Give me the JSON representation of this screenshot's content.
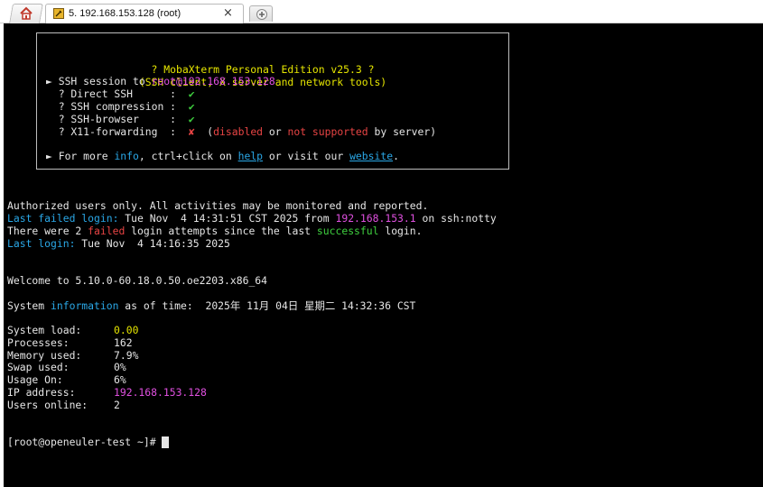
{
  "tabs": {
    "session_title": "5. 192.168.153.128 (root)",
    "close_symbol": "×"
  },
  "banner": {
    "title": "? MobaXterm Personal Edition v25.3 ?",
    "subtitle": "(SSH client, X server and network tools)",
    "session_prefix": "► SSH session to ",
    "session_target": "root@192.168.153.128",
    "direct_ssh": "  ? Direct SSH      :  ",
    "compression": "  ? SSH compression :  ",
    "browser": "  ? SSH-browser     :  ",
    "x11": "  ? X11-forwarding  :  ",
    "check": "✔",
    "cross": "✘",
    "x11_note_1": "  (",
    "x11_note_disabled": "disabled",
    "x11_note_or": " or ",
    "x11_note_not_supported": "not supported",
    "x11_note_end": " by server)",
    "more_prefix": "► For more ",
    "more_info": "info",
    "more_mid": ", ctrl+click on ",
    "more_help": "help",
    "more_mid2": " or visit our ",
    "more_website": "website",
    "more_end": "."
  },
  "motd": {
    "authorized": "Authorized users only. All activities may be monitored and reported.",
    "last_failed_label": "Last failed login:",
    "last_failed_time": " Tue Nov  4 14:31:51 CST 2025 from ",
    "last_failed_ip": "192.168.153.1",
    "last_failed_end": " on ssh:notty",
    "attempts_1": "There were 2 ",
    "attempts_failed": "failed",
    "attempts_2": " login attempts since the last ",
    "attempts_successful": "successful",
    "attempts_3": " login.",
    "last_login_label": "Last login:",
    "last_login_time": " Tue Nov  4 14:16:35 2025",
    "welcome": "Welcome to 5.10.0-60.18.0.50.oe2203.x86_64",
    "sysinfo_1": "System ",
    "sysinfo_info": "information",
    "sysinfo_2": " as of time:  2025年 11月 04日 星期二 14:32:36 CST"
  },
  "stats": [
    {
      "label": "System load:",
      "value": "0.00",
      "color": "yellow"
    },
    {
      "label": "Processes:",
      "value": "162",
      "color": "plain"
    },
    {
      "label": "Memory used:",
      "value": "7.9%",
      "color": "plain"
    },
    {
      "label": "Swap used:",
      "value": "0%",
      "color": "plain"
    },
    {
      "label": "Usage On:",
      "value": "6%",
      "color": "plain"
    },
    {
      "label": "IP address:",
      "value": "192.168.153.128",
      "color": "magenta"
    },
    {
      "label": "Users online:",
      "value": "2",
      "color": "plain"
    }
  ],
  "prompt": "[root@openeuler-test ~]# ",
  "colors": {
    "background": "#000000",
    "yellow": "#e5e500",
    "magenta": "#e050e0",
    "green": "#3fd13f",
    "red": "#e84444",
    "cyan": "#2aa7e6"
  },
  "icons": [
    "home-icon",
    "terminal-session-icon",
    "close-icon",
    "new-tab-icon"
  ]
}
